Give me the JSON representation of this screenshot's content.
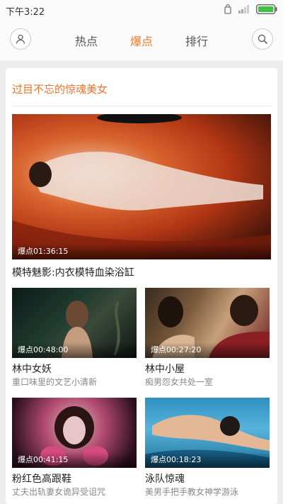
{
  "status": {
    "time": "下午3:22"
  },
  "nav": {
    "tabs": [
      {
        "label": "热点",
        "active": false
      },
      {
        "label": "爆点",
        "active": true
      },
      {
        "label": "排行",
        "active": false
      }
    ],
    "accent": "#f07a2e"
  },
  "section": {
    "title": "过目不忘的惊魂美女"
  },
  "featured": {
    "time": "爆点01:36:15",
    "title": "模特魅影:内衣模特血染浴缸"
  },
  "videos": [
    {
      "time": "爆点00:48:00",
      "title": "林中女妖",
      "sub": "重口味里的文艺小清新"
    },
    {
      "time": "爆点00:27:20",
      "title": "林中小屋",
      "sub": "痴男怨女共处一室"
    },
    {
      "time": "爆点00:41:15",
      "title": "粉红色高跟鞋",
      "sub": "丈夫出轨妻女诡异受诅咒"
    },
    {
      "time": "爆点00:18:23",
      "title": "泳队惊魂",
      "sub": "美男手把手教女神学游泳"
    }
  ]
}
